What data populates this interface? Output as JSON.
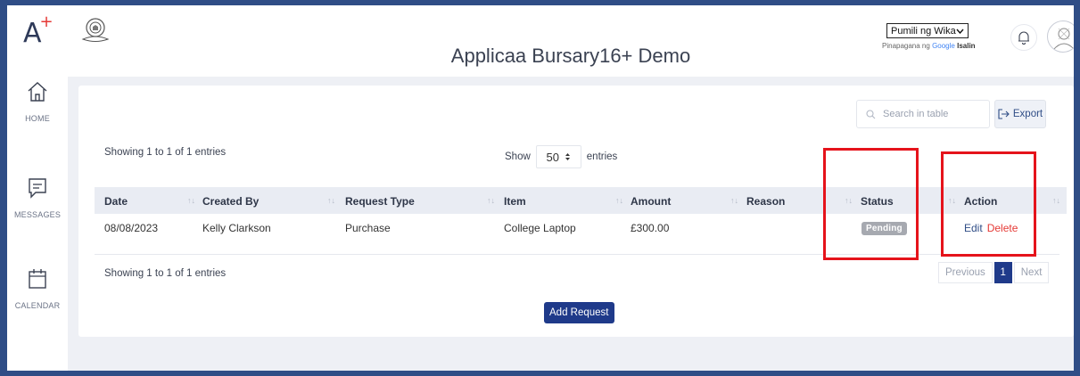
{
  "app": {
    "title": "Applicaa Bursary16+ Demo"
  },
  "sidebar": {
    "logo": "A",
    "logo_plus": "+",
    "items": [
      {
        "label": "HOME",
        "icon": "home-icon"
      },
      {
        "label": "MESSAGES",
        "icon": "message-icon"
      },
      {
        "label": "CALENDAR",
        "icon": "calendar-icon"
      }
    ]
  },
  "header": {
    "language_select": "Pumili ng Wika",
    "powered_prefix": "Pinapagana ng",
    "powered_google": "Google",
    "powered_action": "Isalin"
  },
  "table_controls": {
    "search_placeholder": "Search in table",
    "export_label": "Export",
    "show_label": "Show",
    "entries_label": "entries",
    "page_length": "50",
    "info_text": "Showing 1 to 1 of 1 entries"
  },
  "table": {
    "columns": [
      "Date",
      "Created By",
      "Request Type",
      "Item",
      "Amount",
      "Reason",
      "Status",
      "Action"
    ],
    "rows": [
      {
        "date": "08/08/2023",
        "created_by": "Kelly Clarkson",
        "request_type": "Purchase",
        "item": "College Laptop",
        "amount": "£300.00",
        "reason": "",
        "status": "Pending",
        "actions": {
          "edit": "Edit",
          "delete": "Delete"
        }
      }
    ]
  },
  "pagination": {
    "previous": "Previous",
    "current": "1",
    "next": "Next"
  },
  "buttons": {
    "add_request": "Add Request"
  },
  "colors": {
    "primary": "#1f3a8a",
    "frame": "#2f4d86",
    "danger": "#e53935",
    "highlight": "#e5131b",
    "badge": "#a6a9b0"
  }
}
